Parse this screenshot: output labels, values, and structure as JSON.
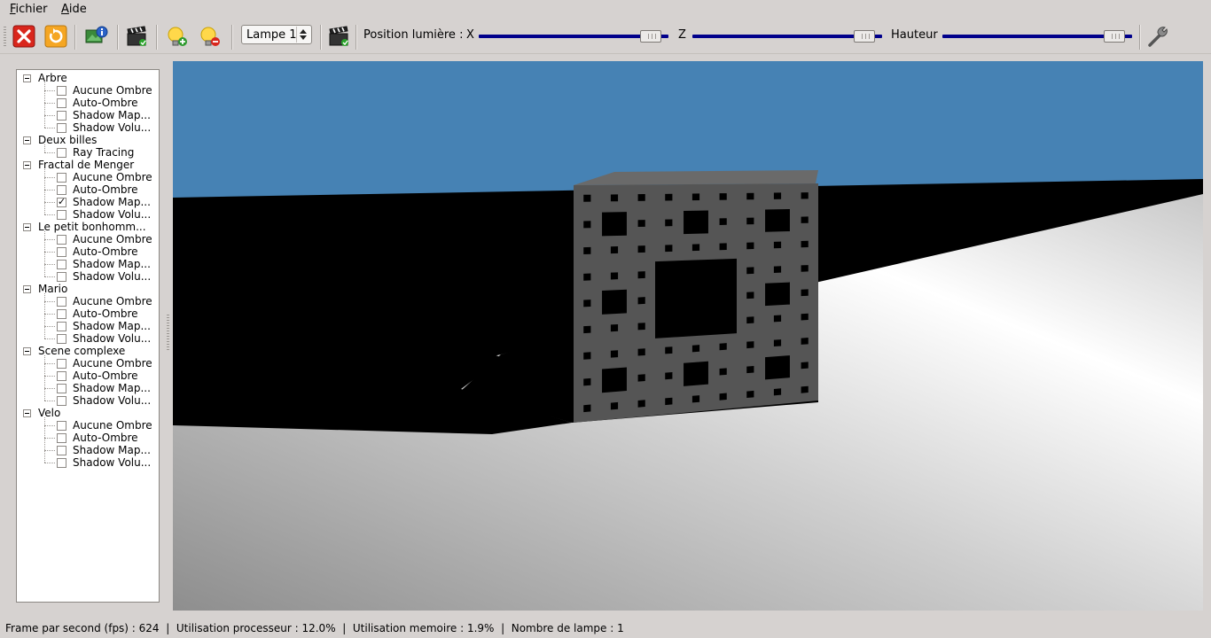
{
  "menubar": {
    "items": [
      {
        "label": "Fichier",
        "mnemonic": "F",
        "rest": "ichier"
      },
      {
        "label": "Aide",
        "mnemonic": "A",
        "rest": "ide"
      }
    ]
  },
  "toolbar": {
    "icons": [
      "close-red-x-icon",
      "refresh-icon",
      "scene-info-icon",
      "clapperboard-icon",
      "add-light-icon",
      "remove-light-icon",
      "clapperboard-icon",
      "wrench-icon"
    ],
    "lamp_select_value": "Lampe 1",
    "position_label": "Position lumière :",
    "x_label": "X",
    "z_label": "Z",
    "height_label": "Hauteur",
    "slider_x_value": 0.96,
    "slider_z_value": 0.96,
    "slider_height_value": 0.96
  },
  "tree": {
    "groups": [
      {
        "label": "Arbre",
        "items": [
          {
            "label": "Aucune Ombre",
            "checked": false
          },
          {
            "label": "Auto-Ombre",
            "checked": false
          },
          {
            "label": "Shadow Map...",
            "checked": false
          },
          {
            "label": "Shadow Volu...",
            "checked": false
          }
        ]
      },
      {
        "label": "Deux billes",
        "items": [
          {
            "label": "Ray Tracing",
            "checked": false
          }
        ]
      },
      {
        "label": "Fractal de Menger",
        "items": [
          {
            "label": "Aucune Ombre",
            "checked": false
          },
          {
            "label": "Auto-Ombre",
            "checked": false
          },
          {
            "label": "Shadow Map...",
            "checked": true
          },
          {
            "label": "Shadow Volu...",
            "checked": false
          }
        ]
      },
      {
        "label": "Le petit bonhomm...",
        "items": [
          {
            "label": "Aucune Ombre",
            "checked": false
          },
          {
            "label": "Auto-Ombre",
            "checked": false
          },
          {
            "label": "Shadow Map...",
            "checked": false
          },
          {
            "label": "Shadow Volu...",
            "checked": false
          }
        ]
      },
      {
        "label": "Mario",
        "items": [
          {
            "label": "Aucune Ombre",
            "checked": false
          },
          {
            "label": "Auto-Ombre",
            "checked": false
          },
          {
            "label": "Shadow Map...",
            "checked": false
          },
          {
            "label": "Shadow Volu...",
            "checked": false
          }
        ]
      },
      {
        "label": "Scene complexe",
        "items": [
          {
            "label": "Aucune Ombre",
            "checked": false
          },
          {
            "label": "Auto-Ombre",
            "checked": false
          },
          {
            "label": "Shadow Map...",
            "checked": false
          },
          {
            "label": "Shadow Volu...",
            "checked": false
          }
        ]
      },
      {
        "label": "Velo",
        "items": [
          {
            "label": "Aucune Ombre",
            "checked": false
          },
          {
            "label": "Auto-Ombre",
            "checked": false
          },
          {
            "label": "Shadow Map...",
            "checked": false
          },
          {
            "label": "Shadow Volu...",
            "checked": false
          }
        ]
      }
    ]
  },
  "viewport": {
    "sky_color": "#4682b4",
    "cube_color": "#555555"
  },
  "statusbar": {
    "text": "Frame par second (fps) : 624  |  Utilisation processeur : 12.0%  |  Utilisation memoire : 1.9%  |  Nombre de lampe : 1"
  }
}
